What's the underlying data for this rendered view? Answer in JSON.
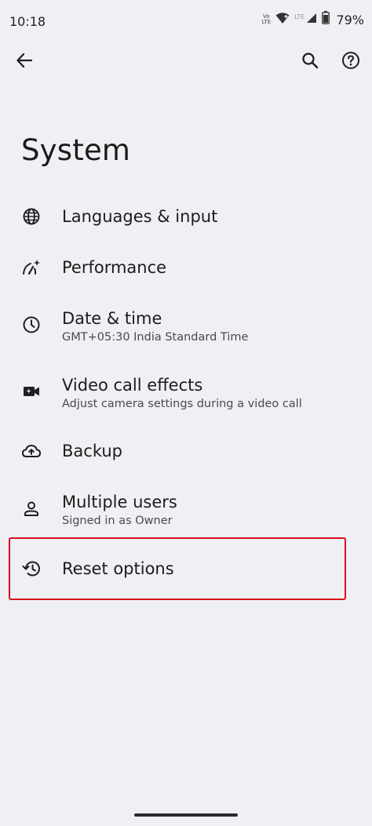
{
  "status_bar": {
    "time": "10:18",
    "volte_top": "Vo",
    "volte_mid": "LTE",
    "lte": "LTE",
    "battery_pct": "79%"
  },
  "topbar": {
    "back_icon": "arrow-back-icon",
    "search_icon": "search-icon",
    "help_icon": "help-circle-icon"
  },
  "page": {
    "title": "System"
  },
  "items": [
    {
      "title": "Languages & input",
      "subtitle": "",
      "icon": "globe-icon"
    },
    {
      "title": "Performance",
      "subtitle": "",
      "icon": "performance-gauge-icon"
    },
    {
      "title": "Date & time",
      "subtitle": "GMT+05:30 India Standard Time",
      "icon": "clock-icon"
    },
    {
      "title": "Video call effects",
      "subtitle": "Adjust camera settings during a video call",
      "icon": "video-camera-icon"
    },
    {
      "title": "Backup",
      "subtitle": "",
      "icon": "cloud-upload-icon"
    },
    {
      "title": "Multiple users",
      "subtitle": "Signed in as Owner",
      "icon": "person-icon"
    },
    {
      "title": "Reset options",
      "subtitle": "",
      "icon": "history-icon"
    }
  ],
  "colors": {
    "background": "#eef0f3",
    "highlight": "#d8111b"
  }
}
